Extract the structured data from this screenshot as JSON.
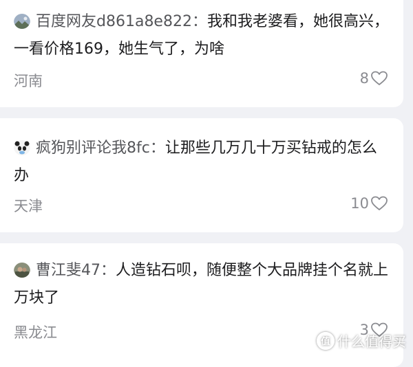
{
  "comments": [
    {
      "user": "百度网友d861a8e822",
      "text": "我和我老婆看，她很高兴，一看价格169，她生气了，为啥",
      "region": "河南",
      "likes": "8",
      "avatar_icon": "landscape-avatar-icon"
    },
    {
      "user": "疯狗别评论我8fc",
      "text": "让那些几万几十万买钻戒的怎么办",
      "region": "天津",
      "likes": "10",
      "avatar_icon": "panda-avatar-icon"
    },
    {
      "user": "曹江斐47",
      "text": "人造钻石呗，随便整个大品牌挂个名就上万块了",
      "region": "黑龙江",
      "likes": "3",
      "avatar_icon": "photo-avatar-icon"
    }
  ],
  "separator": "：",
  "watermark": {
    "logo_text": "值",
    "text": "什么值得买"
  },
  "colors": {
    "background": "#f0f1f5",
    "card": "#ffffff",
    "username": "#55565a",
    "meta": "#8a8b90"
  }
}
